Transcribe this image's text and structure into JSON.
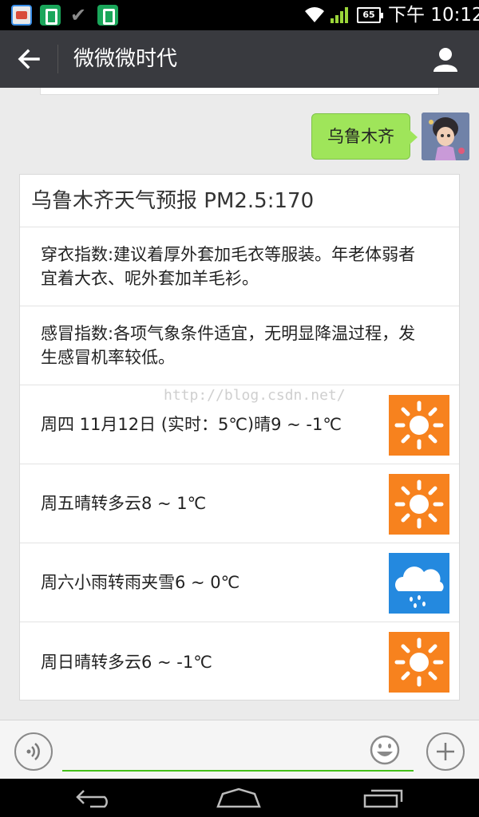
{
  "status_bar": {
    "battery": "65",
    "time": "下午 10:12",
    "icons": [
      "app-icon",
      "r-app-icon",
      "check-icon",
      "r-app-icon",
      "wifi-icon",
      "signal-icon",
      "battery-icon"
    ]
  },
  "header": {
    "title": "微微微时代",
    "back_icon": "back-arrow-icon",
    "profile_icon": "person-icon"
  },
  "chat": {
    "sent_message": "乌鲁木齐",
    "weather_card": {
      "title": "乌鲁木齐天气预报 PM2.5:170",
      "rows": [
        {
          "text": "穿衣指数:建议着厚外套加毛衣等服装。年老体弱者宜着大衣、呢外套加羊毛衫。"
        },
        {
          "text": "感冒指数:各项气象条件适宜，无明显降温过程，发生感冒机率较低。"
        },
        {
          "text": "周四 11月12日 (实时：5℃)晴9 ~ -1℃",
          "icon": "sun-icon"
        },
        {
          "text": "周五晴转多云8 ~ 1℃",
          "icon": "sun-icon"
        },
        {
          "text": "周六小雨转雨夹雪6 ~ 0℃",
          "icon": "rain-cloud-icon"
        },
        {
          "text": "周日晴转多云6 ~ -1℃",
          "icon": "sun-icon"
        }
      ],
      "watermark": "http://blog.csdn.net/"
    }
  },
  "input_bar": {
    "placeholder": "",
    "value": "",
    "icons": [
      "voice-icon",
      "emoji-icon",
      "plus-icon"
    ]
  },
  "nav_bar": {
    "icons": [
      "nav-back-icon",
      "nav-home-icon",
      "nav-recents-icon"
    ]
  },
  "colors": {
    "title_bar": "#393a3f",
    "bubble_green": "#9fe55a",
    "sun_orange": "#f7821e",
    "rain_blue": "#2489df",
    "input_underline": "#45c01a"
  }
}
